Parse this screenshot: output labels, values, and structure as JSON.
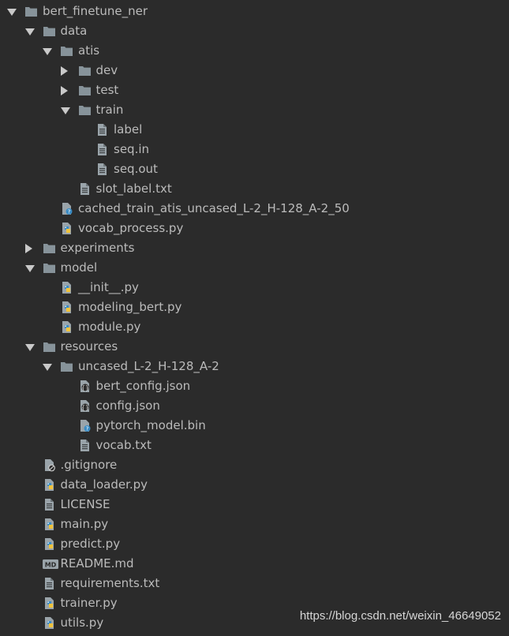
{
  "tree": [
    {
      "label": "bert_finetune_ner",
      "type": "folder",
      "state": "open",
      "depth": 0
    },
    {
      "label": "data",
      "type": "folder",
      "state": "open",
      "depth": 1
    },
    {
      "label": "atis",
      "type": "folder",
      "state": "open",
      "depth": 2
    },
    {
      "label": "dev",
      "type": "folder",
      "state": "closed",
      "depth": 3
    },
    {
      "label": "test",
      "type": "folder",
      "state": "closed",
      "depth": 3
    },
    {
      "label": "train",
      "type": "folder",
      "state": "open",
      "depth": 3
    },
    {
      "label": "label",
      "type": "text",
      "depth": 4
    },
    {
      "label": "seq.in",
      "type": "text",
      "depth": 4
    },
    {
      "label": "seq.out",
      "type": "text",
      "depth": 4
    },
    {
      "label": "slot_label.txt",
      "type": "text",
      "depth": 3
    },
    {
      "label": "cached_train_atis_uncased_L-2_H-128_A-2_50",
      "type": "unknown",
      "depth": 2
    },
    {
      "label": "vocab_process.py",
      "type": "python",
      "depth": 2
    },
    {
      "label": "experiments",
      "type": "folder",
      "state": "closed",
      "depth": 1
    },
    {
      "label": "model",
      "type": "folder",
      "state": "open",
      "depth": 1
    },
    {
      "label": "__init__.py",
      "type": "python",
      "depth": 2
    },
    {
      "label": "modeling_bert.py",
      "type": "python",
      "depth": 2
    },
    {
      "label": "module.py",
      "type": "python",
      "depth": 2
    },
    {
      "label": "resources",
      "type": "folder",
      "state": "open",
      "depth": 1
    },
    {
      "label": "uncased_L-2_H-128_A-2",
      "type": "folder",
      "state": "open",
      "depth": 2
    },
    {
      "label": "bert_config.json",
      "type": "json",
      "depth": 3
    },
    {
      "label": "config.json",
      "type": "json",
      "depth": 3
    },
    {
      "label": "pytorch_model.bin",
      "type": "unknown",
      "depth": 3
    },
    {
      "label": "vocab.txt",
      "type": "text",
      "depth": 3
    },
    {
      "label": ".gitignore",
      "type": "gitignore",
      "depth": 1
    },
    {
      "label": "data_loader.py",
      "type": "python",
      "depth": 1
    },
    {
      "label": "LICENSE",
      "type": "text",
      "depth": 1
    },
    {
      "label": "main.py",
      "type": "python",
      "depth": 1
    },
    {
      "label": "predict.py",
      "type": "python",
      "depth": 1
    },
    {
      "label": "README.md",
      "type": "markdown",
      "depth": 1
    },
    {
      "label": "requirements.txt",
      "type": "text",
      "depth": 1
    },
    {
      "label": "trainer.py",
      "type": "python",
      "depth": 1
    },
    {
      "label": "utils.py",
      "type": "python",
      "depth": 1
    }
  ],
  "watermark": "https://blog.csdn.net/weixin_46649052",
  "colors": {
    "background": "#2b2b2b",
    "text": "#bbbbbb",
    "folder": "#87939a",
    "python_blue": "#3b8cc4",
    "python_yellow": "#f0c33c"
  }
}
